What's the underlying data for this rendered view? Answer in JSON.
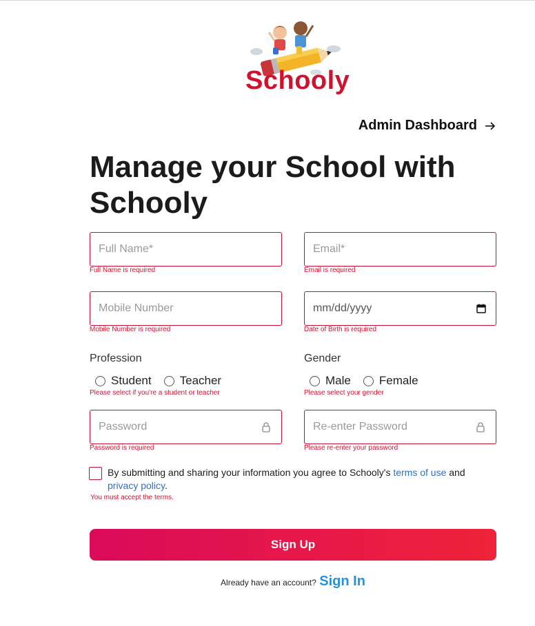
{
  "brand": {
    "name": "Schooly",
    "logo_icon": "pencil-rocket-kids-illustration",
    "brand_color": "#d1122f"
  },
  "nav": {
    "admin_link": "Admin Dashboard",
    "admin_icon": "arrow-right-icon"
  },
  "heading": {
    "line1": "Manage your School with",
    "line2": "Schooly"
  },
  "form": {
    "full_name": {
      "placeholder": "Full Name*",
      "error": "Full Name is required"
    },
    "email": {
      "placeholder": "Email*",
      "error": "Email is required"
    },
    "mobile": {
      "placeholder": "Mobile Number",
      "error": "Mobile Number is required"
    },
    "dob": {
      "placeholder": "mm/dd/yyyy",
      "error": "Date of Birth is required",
      "icon": "calendar-icon"
    },
    "profession": {
      "label": "Profession",
      "options": [
        "Student",
        "Teacher"
      ],
      "error": "Please select if you're a student or teacher"
    },
    "gender": {
      "label": "Gender",
      "options": [
        "Male",
        "Female"
      ],
      "error": "Please select your gender"
    },
    "password": {
      "placeholder": "Password",
      "error": "Password is required",
      "icon": "lock-icon"
    },
    "confirm_password": {
      "placeholder": "Re-enter Password",
      "error": "Please re-enter your password",
      "icon": "lock-icon"
    },
    "terms": {
      "text_before": "By submitting and sharing your information you agree to Schooly's ",
      "terms_link": "terms of use",
      "text_mid": " and ",
      "privacy_link": "privacy policy",
      "text_after": ".",
      "error": "You must accept the terms."
    },
    "submit_label": "Sign Up",
    "error_color": "#d1122f"
  },
  "footer": {
    "prompt": "Already have an account?",
    "signin_label": "Sign In"
  },
  "colors": {
    "button_gradient_start": "#d90b5a",
    "button_gradient_end": "#ee2238",
    "link_blue": "#2691d9"
  }
}
